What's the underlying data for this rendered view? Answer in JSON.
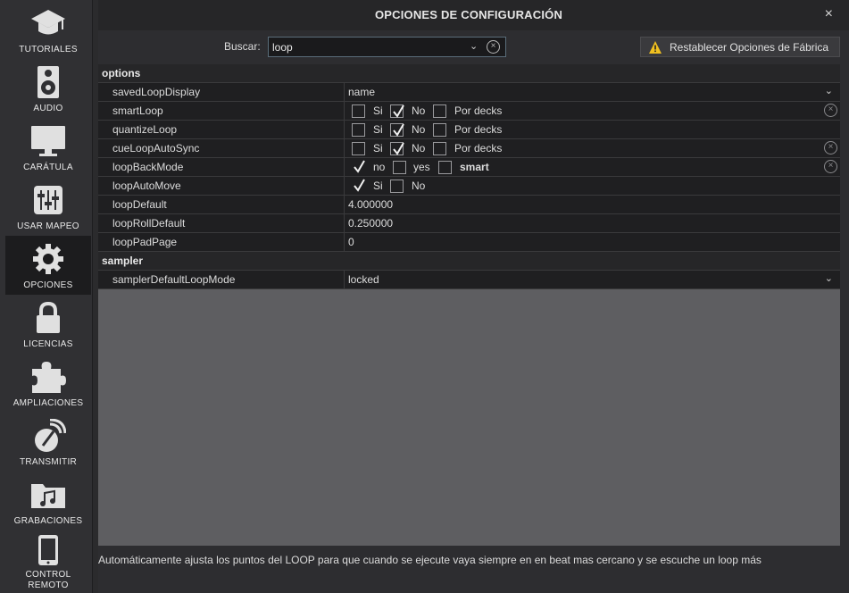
{
  "sidebar": {
    "items": [
      {
        "label": "TUTORIALES",
        "icon": "graduation-cap-icon"
      },
      {
        "label": "AUDIO",
        "icon": "speaker-icon"
      },
      {
        "label": "CARÁTULA",
        "icon": "monitor-icon"
      },
      {
        "label": "USAR MAPEO",
        "icon": "mixer-sliders-icon"
      },
      {
        "label": "OPCIONES",
        "icon": "gear-icon",
        "active": true
      },
      {
        "label": "LICENCIAS",
        "icon": "lock-icon"
      },
      {
        "label": "AMPLIACIONES",
        "icon": "puzzle-icon"
      },
      {
        "label": "TRANSMITIR",
        "icon": "broadcast-icon"
      },
      {
        "label": "GRABACIONES",
        "icon": "music-folder-icon"
      },
      {
        "label": "CONTROL REMOTO",
        "icon": "phone-icon"
      }
    ]
  },
  "header": {
    "title": "OPCIONES DE CONFIGURACIÓN",
    "close": "×"
  },
  "search": {
    "label": "Buscar:",
    "value": "loop"
  },
  "reset_button": {
    "label": "Restablecer Opciones de Fábrica"
  },
  "table": {
    "groups": [
      {
        "title": "options"
      },
      {
        "title": "sampler"
      }
    ],
    "rows": [
      {
        "name": "savedLoopDisplay",
        "value": "name"
      },
      {
        "name": "smartLoop",
        "opts": [
          "Si",
          "No",
          "Por decks"
        ],
        "checked": "No"
      },
      {
        "name": "quantizeLoop",
        "opts": [
          "Si",
          "No",
          "Por decks"
        ],
        "checked": "No"
      },
      {
        "name": "cueLoopAutoSync",
        "opts": [
          "Si",
          "No",
          "Por decks"
        ],
        "checked": "No"
      },
      {
        "name": "loopBackMode",
        "opts": [
          "no",
          "yes",
          "smart"
        ],
        "checked": "no",
        "bold": "smart"
      },
      {
        "name": "loopAutoMove",
        "opts": [
          "Si",
          "No"
        ],
        "checked": "Si"
      },
      {
        "name": "loopDefault",
        "value": "4.000000"
      },
      {
        "name": "loopRollDefault",
        "value": "0.250000"
      },
      {
        "name": "loopPadPage",
        "value": "0"
      },
      {
        "name": "samplerDefaultLoopMode",
        "value": "locked"
      }
    ]
  },
  "help_text": "Automáticamente ajusta los puntos del LOOP para que cuando se ejecute vaya siempre en en beat mas cercano y se escuche un loop más",
  "colors": {
    "background": "#2d2d30",
    "sidebar": "#303033",
    "warning": "#f0c020"
  }
}
